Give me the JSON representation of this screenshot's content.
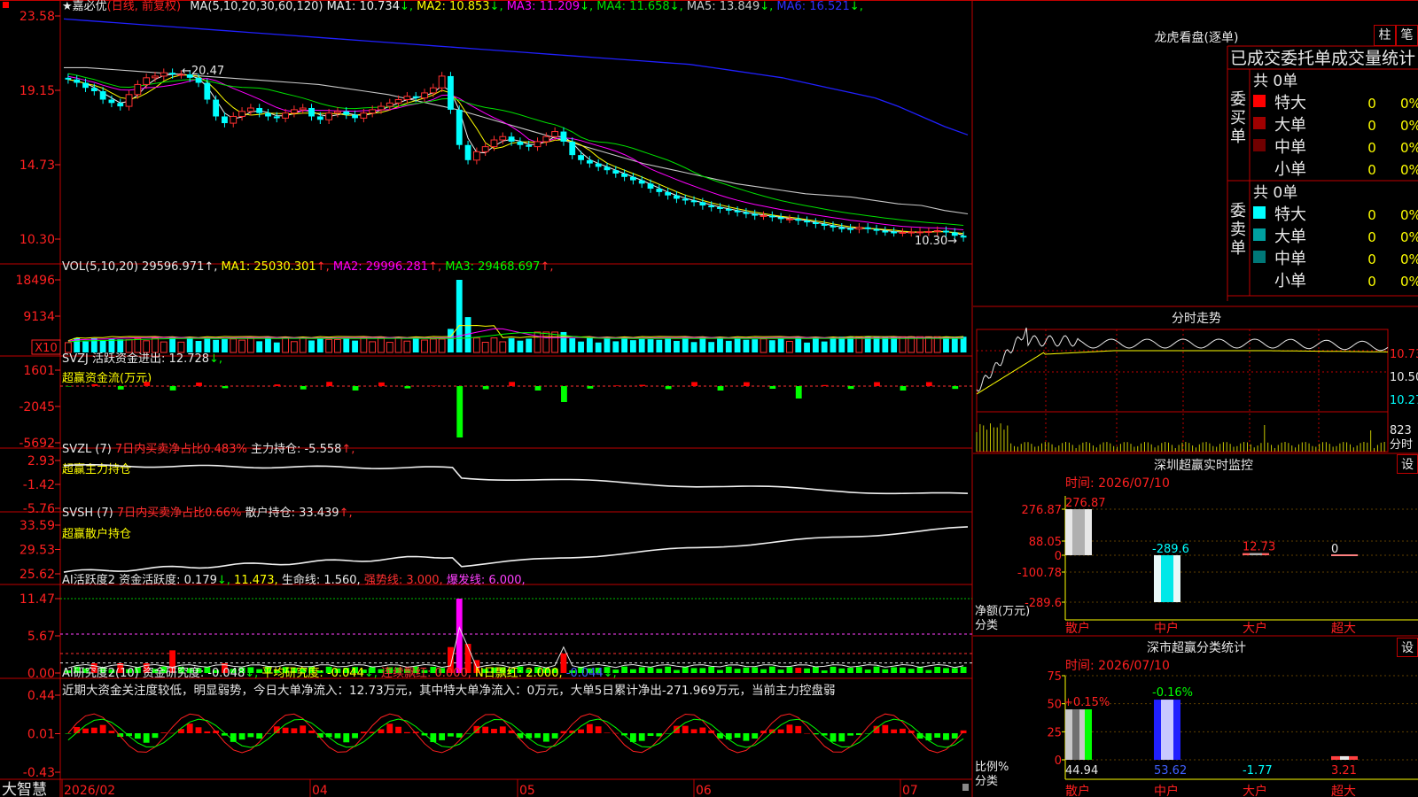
{
  "title": {
    "stock_name": "嘉必优",
    "period": "日线",
    "adjust": "前复权"
  },
  "main_chart": {
    "ma_header": "MA(5,10,20,30,60,120)",
    "ma": [
      {
        "label": "MA1",
        "value": "10.734",
        "dir": "↓",
        "color": "#f0f0f0"
      },
      {
        "label": "MA2",
        "value": "10.853",
        "dir": "↓",
        "color": "#ffff00"
      },
      {
        "label": "MA3",
        "value": "11.209",
        "dir": "↓",
        "color": "#ff00ff"
      },
      {
        "label": "MA4",
        "value": "11.658",
        "dir": "↓",
        "color": "#00e000"
      },
      {
        "label": "MA5",
        "value": "13.849",
        "dir": "↓",
        "color": "#c8c8c8"
      },
      {
        "label": "MA6",
        "value": "16.521",
        "dir": "↓",
        "color": "#3030ff"
      }
    ],
    "y_ticks": [
      "23.58",
      "19.15",
      "14.73",
      "10.30"
    ],
    "hi_label": "20.47",
    "lo_label": "10.30"
  },
  "vol_chart": {
    "label": "VOL(5,10,20)",
    "value": "29596.971",
    "items": [
      {
        "label": "MA1",
        "value": "25030.301",
        "dir": "↑",
        "color": "#ffff00"
      },
      {
        "label": "MA2",
        "value": "29996.281",
        "dir": "↑",
        "color": "#ff00ff"
      },
      {
        "label": "MA3",
        "value": "29468.697",
        "dir": "↑",
        "color": "#00ff00"
      }
    ],
    "y_ticks": [
      "18496",
      "9134"
    ],
    "unit": "X10"
  },
  "svzj": {
    "label": "SVZJ",
    "text": "活跃资金进出: 12.728",
    "dir": "↓",
    "sub": "超赢资金流(万元)",
    "y_ticks": [
      "1601",
      "-2045",
      "-5692"
    ]
  },
  "svzl": {
    "label": "SVZL (7)",
    "text1": "7日内买卖净占比0.483%",
    "text2": "主力持仓: -5.558",
    "dir": "↑",
    "sub": "超赢主力持仓",
    "y_ticks": [
      "2.93",
      "-1.42",
      "-5.76"
    ]
  },
  "svsh": {
    "label": "SVSH (7)",
    "text1": "7日内买卖净占比0.66%",
    "text2": "散户持仓: 33.439",
    "dir": "↑",
    "sub": "超赢散户持仓",
    "y_ticks": [
      "33.59",
      "29.53",
      "25.62"
    ]
  },
  "ai_active": {
    "label": "AI活跃度2",
    "items": [
      {
        "text": "资金活跃度: 0.179",
        "dir": "↓",
        "color": "#e8e8e8"
      },
      {
        "text": "11.473",
        "dir": "",
        "color": "#ffff00"
      },
      {
        "text": "生命线: 1.560",
        "dir": "",
        "color": "#e8e8e8"
      },
      {
        "text": "强势线: 3.000",
        "dir": "",
        "color": "#ff3030"
      },
      {
        "text": "爆发线: 6.000",
        "dir": "",
        "color": "#ff40ff"
      }
    ],
    "y_ticks": [
      "11.47",
      "5.67",
      "0.00"
    ]
  },
  "ai_research": {
    "label": "AI研究度2(10)",
    "items": [
      {
        "text": "资金研究度: -0.048",
        "dir": "↓",
        "color": "#e8e8e8"
      },
      {
        "text": "平均研究度: -0.044",
        "dir": "↓",
        "color": "#ffff00"
      },
      {
        "text": "连续飘红: 0.000",
        "dir": "",
        "color": "#ff3030"
      },
      {
        "text": "N日飘红: 2.000",
        "dir": "",
        "color": "#ffff00"
      },
      {
        "text": "-0.044",
        "dir": "↓",
        "color": "#4060ff"
      }
    ],
    "comment": "近期大资金关注度较低，明显弱势，今日大单净流入：12.73万元，其中特大单净流入：0万元，大单5日累计净出-271.969万元，当前主力控盘弱",
    "y_ticks": [
      "0.44",
      "0.01",
      "-0.43"
    ]
  },
  "x_axis": {
    "labels": [
      "2026/02",
      "04",
      "05",
      "06",
      "07"
    ],
    "brand": "大智慧"
  },
  "dragon": {
    "title": "龙虎看盘(逐单)",
    "btn_bar": "柱",
    "btn_pen": "笔",
    "header": "已成交委托单成交量统计",
    "buy": {
      "side": "委买单",
      "count": "共 0单",
      "rows": [
        {
          "label": "特大",
          "qty": "0",
          "pct": "0%",
          "color": "#ff0000"
        },
        {
          "label": "大单",
          "qty": "0",
          "pct": "0%",
          "color": "#a00000"
        },
        {
          "label": "中单",
          "qty": "0",
          "pct": "0%",
          "color": "#700000"
        },
        {
          "label": "小单",
          "qty": "0",
          "pct": "0%",
          "color": ""
        }
      ]
    },
    "sell": {
      "side": "委卖单",
      "count": "共 0单",
      "rows": [
        {
          "label": "特大",
          "qty": "0",
          "pct": "0%",
          "color": "#00ffff"
        },
        {
          "label": "大单",
          "qty": "0",
          "pct": "0%",
          "color": "#00a0a0"
        },
        {
          "label": "中单",
          "qty": "0",
          "pct": "0%",
          "color": "#007878"
        },
        {
          "label": "小单",
          "qty": "0",
          "pct": "0%",
          "color": ""
        }
      ]
    }
  },
  "intraday": {
    "title": "分时走势",
    "y_ticks": [
      "10.73",
      "10.50",
      "10.27"
    ],
    "vol_tick": "823",
    "unit": "分时"
  },
  "monitor": {
    "title": "深圳超赢实时监控",
    "btn": "设",
    "time": "时间: 2026/07/10",
    "y_ticks": [
      "276.87",
      "88.05",
      "0",
      "-100.78",
      "-289.6"
    ],
    "y_label1": "净额(万元)",
    "y_label2": "分类",
    "bars": [
      {
        "cat": "散户",
        "value": 276.87,
        "label": "276.87"
      },
      {
        "cat": "中户",
        "value": -289.6,
        "label": "-289.6"
      },
      {
        "cat": "大户",
        "value": 12.73,
        "label": "12.73"
      },
      {
        "cat": "超大",
        "value": 0,
        "label": "0"
      }
    ]
  },
  "classify": {
    "title": "深市超赢分类统计",
    "btn": "设",
    "time": "时间: 2026/07/10",
    "y_ticks": [
      "75",
      "50",
      "25",
      "0"
    ],
    "y_label1": "比例%",
    "y_label2": "分类",
    "bars": [
      {
        "cat": "散户",
        "value": 44.94,
        "label": "44.94",
        "top": "+0.15%"
      },
      {
        "cat": "中户",
        "value": 53.62,
        "label": "53.62",
        "top": "-0.16%"
      },
      {
        "cat": "大户",
        "value": -1.77,
        "label": "-1.77",
        "top": ""
      },
      {
        "cat": "超大",
        "value": 3.21,
        "label": "3.21",
        "top": ""
      }
    ]
  },
  "chart_data": [
    {
      "type": "candlestick",
      "title": "嘉必优",
      "ylim": [
        10.3,
        23.58
      ],
      "y_ticks": [
        23.58,
        19.15,
        14.73,
        10.3
      ],
      "dates_hint": [
        "2026/02",
        "04",
        "05",
        "06",
        "07"
      ],
      "close": [
        19.8,
        19.6,
        19.3,
        19.1,
        18.6,
        18.4,
        18.2,
        18.9,
        19.5,
        19.9,
        20.0,
        20.2,
        20.1,
        20.1,
        19.9,
        19.6,
        18.6,
        17.6,
        17.2,
        17.6,
        17.9,
        18.1,
        17.8,
        17.6,
        17.5,
        17.8,
        18.0,
        18.1,
        17.6,
        17.4,
        17.8,
        17.9,
        17.7,
        17.5,
        17.8,
        18.0,
        18.2,
        18.4,
        18.6,
        18.8,
        18.7,
        19.0,
        19.3,
        20.0,
        18.0,
        15.9,
        15.0,
        15.5,
        15.8,
        16.2,
        16.4,
        16.1,
        15.9,
        15.8,
        16.1,
        16.4,
        16.7,
        16.1,
        15.3,
        15.0,
        14.8,
        14.6,
        14.4,
        14.2,
        14.0,
        13.8,
        13.6,
        13.3,
        13.1,
        12.9,
        12.7,
        12.6,
        12.5,
        12.3,
        12.2,
        12.1,
        12.0,
        11.9,
        11.8,
        11.7,
        11.7,
        11.6,
        11.5,
        11.5,
        11.4,
        11.3,
        11.2,
        11.1,
        11.0,
        10.95,
        10.9,
        11.0,
        10.9,
        10.8,
        10.75,
        10.7,
        10.7,
        10.72,
        10.73,
        10.75,
        10.8,
        10.7,
        10.5,
        10.4
      ],
      "ma_lines": {
        "MA5": [
          20.5,
          20.5,
          20.4,
          20.3,
          20.2,
          20.1,
          20.0,
          19.9,
          19.8,
          19.7,
          19.6,
          19.5,
          19.3,
          19.1,
          18.9,
          18.6,
          18.3,
          18.0,
          17.6,
          17.2,
          16.8,
          16.4,
          16.0,
          15.6,
          15.2,
          14.8,
          14.5,
          14.2,
          13.9,
          13.6,
          13.4,
          13.2,
          13.0,
          12.9,
          12.8,
          12.6,
          12.4,
          12.3,
          12.0,
          11.8
        ],
        "MA6": [
          23.4,
          23.3,
          23.2,
          23.1,
          23.0,
          22.9,
          22.8,
          22.7,
          22.6,
          22.5,
          22.4,
          22.3,
          22.2,
          22.1,
          22.0,
          21.9,
          21.8,
          21.7,
          21.6,
          21.5,
          21.4,
          21.3,
          21.2,
          21.1,
          21.0,
          20.9,
          20.8,
          20.7,
          20.5,
          20.3,
          20.1,
          19.9,
          19.6,
          19.3,
          19.0,
          18.7,
          18.2,
          17.6,
          17.0,
          16.5
        ]
      }
    },
    {
      "type": "bar",
      "title": "VOL(5,10,20)",
      "ylim": [
        0,
        18496
      ],
      "y_ticks": [
        18496,
        9134
      ]
    },
    {
      "type": "bar",
      "title": "超赢资金流(万元)",
      "ylim": [
        -5692,
        1601
      ],
      "y_ticks": [
        1601,
        -2045,
        -5692
      ]
    },
    {
      "type": "line",
      "title": "超赢主力持仓",
      "ylim": [
        -5.76,
        2.93
      ],
      "y_ticks": [
        2.93,
        -1.42,
        -5.76
      ]
    },
    {
      "type": "line",
      "title": "超赢散户持仓",
      "ylim": [
        25.62,
        33.59
      ],
      "y_ticks": [
        33.59,
        29.53,
        25.62
      ]
    },
    {
      "type": "bar",
      "title": "AI活跃度2",
      "ylim": [
        0,
        11.47
      ],
      "y_ticks": [
        11.47,
        5.67,
        0.0
      ]
    },
    {
      "type": "bar",
      "title": "AI研究度2(10)",
      "ylim": [
        -0.43,
        0.44
      ],
      "y_ticks": [
        0.44,
        0.01,
        -0.43
      ]
    },
    {
      "type": "bar",
      "title": "深圳超赢实时监控",
      "categories": [
        "散户",
        "中户",
        "大户",
        "超大"
      ],
      "values": [
        276.87,
        -289.6,
        12.73,
        0
      ],
      "ylabel": "净额(万元)"
    },
    {
      "type": "bar",
      "title": "深市超赢分类统计",
      "categories": [
        "散户",
        "中户",
        "大户",
        "超大"
      ],
      "values": [
        44.94,
        53.62,
        -1.77,
        3.21
      ],
      "ylabel": "比例%"
    }
  ]
}
